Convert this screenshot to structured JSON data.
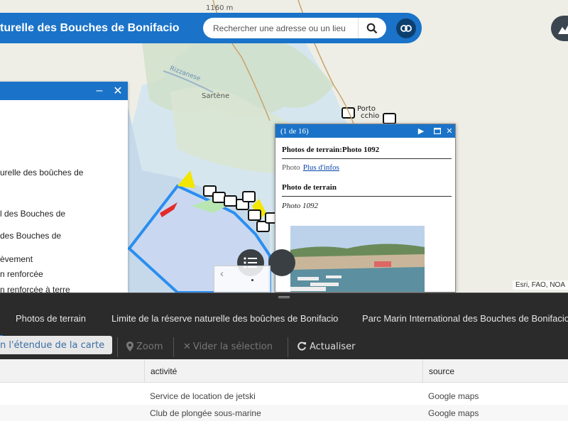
{
  "header": {
    "title": "turelle des Bouches de Bonifacio",
    "search_placeholder": "Rechercher une adresse ou un lieu",
    "search_icon": "search-icon",
    "link_icon": "link-icon"
  },
  "map": {
    "labels": {
      "elevation": "1160 m",
      "sartene": "Sartène",
      "rizzanese": "Rizzanese",
      "porto": "Porto",
      "vecchio": "cchio"
    },
    "attribution": "Esri, FAO, NOA"
  },
  "left_panel": {
    "minimize": "–",
    "close": "✕",
    "items": [
      "urelle des boûches de",
      "l des Bouches de",
      " des Bouches de",
      "èvement",
      "n renforcée",
      "n renforcée à terre"
    ]
  },
  "popup": {
    "counter": "(1 de 16)",
    "section_title": "Photos de terrain:Photo 1092",
    "photo_label": "Photo",
    "more_info": "Plus d'infos",
    "field_title": "Photo de terrain",
    "field_value": "Photo 1092"
  },
  "bottom": {
    "tabs": [
      "Photos de terrain",
      "Limite de la réserve naturelle des boûches de Bonifacio",
      "Parc Marin International des Bouches de Bonifacio"
    ],
    "toolbar": {
      "extent": "n l'étendue de la carte",
      "zoom": "Zoom",
      "clear": "Vider la sélection",
      "refresh": "Actualiser"
    },
    "columns": [
      "activité",
      "source"
    ],
    "rows": [
      {
        "activite": "Service de location de jetski",
        "source": "Google maps"
      },
      {
        "activite": "Club de plongée sous-marine",
        "source": "Google maps"
      }
    ]
  },
  "colors": {
    "brand_blue": "#1a73c8",
    "dark_panel": "#2b2b2b",
    "reserve_fill": "#c9d8f0",
    "reserve_border": "#2b8ef0"
  }
}
